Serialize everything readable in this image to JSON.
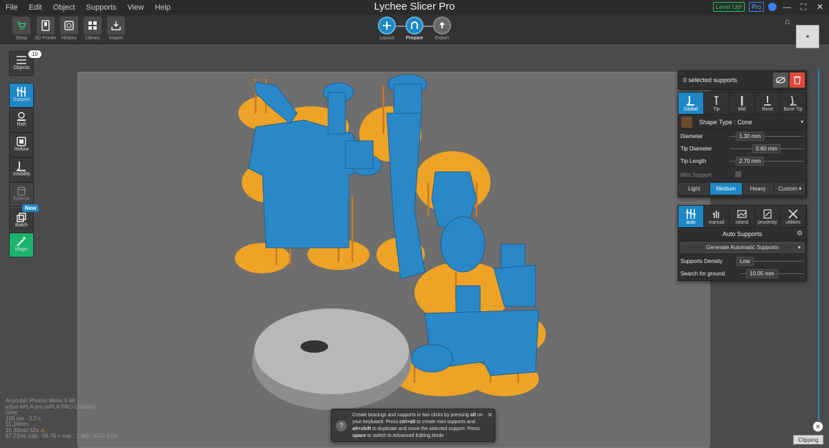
{
  "menu": [
    "File",
    "Edit",
    "Object",
    "Supports",
    "View",
    "Help"
  ],
  "app_title": "Lychee Slicer Pro",
  "menubar_right": {
    "levelup": "Level Up!",
    "pro": "Pro"
  },
  "toolbar": {
    "tools": [
      "Shop",
      "3D Printer",
      "History",
      "Library",
      "Import"
    ],
    "steps": [
      "Layout",
      "Prepare",
      "Export"
    ],
    "active_step": "Prepare"
  },
  "sidebar": {
    "objects_label": "Objects",
    "objects_count": "10",
    "support_label": "Support",
    "raft_label": "Raft",
    "hollow_label": "Hollow",
    "visibility_label": "Visibility",
    "exterior_label": "Exterior",
    "batch_label": "Batch",
    "new_badge": "New",
    "magic_label": "Magic"
  },
  "selection": {
    "text": "0 selected supports"
  },
  "support_settings": {
    "tabs": [
      "Global",
      "Tip",
      "Mid",
      "Base",
      "Base Tip"
    ],
    "active_tab": "Global",
    "shape_type": "Shape Type : Cone",
    "diameter_label": "Diameter",
    "diameter": "1.30 mm",
    "tip_diameter_label": "Tip Diameter",
    "tip_diameter": "0.60 mm",
    "tip_length_label": "Tip Length",
    "tip_length": "2.70 mm",
    "mini_support_label": "Mini Support",
    "density_options": [
      "Light",
      "Medium",
      "Heavy",
      "Custom ▾"
    ],
    "active_density": "Medium"
  },
  "auto_supports": {
    "tabs": [
      "auto",
      "manual",
      "island",
      "proximity",
      "utilities"
    ],
    "active_tab": "auto",
    "title": "Auto Supports",
    "generate_label": "Generate Automatic Supports",
    "density_label": "Supports Density",
    "density_value": "Low",
    "ground_label": "Search for ground",
    "ground_value": "10.05 mm"
  },
  "clipping_label": "Clipping",
  "tooltip": {
    "line1": "Create bracings and supports in two clicks by pressing",
    "key1": "alt",
    "line2": "on your keyboard. Press",
    "key2": "ctrl+alt",
    "line3": "to create mini supports",
    "line4": "and",
    "key3": "alt+shift",
    "line5": "to duplicate and move the selected support.",
    "line6": "Press",
    "key4": "space",
    "line7": "to switch to Advanced Editing Mode"
  },
  "info": {
    "printer": "Anycubic Photon Mono X 6K",
    "resin": "eSun ePLA pro (ePLA PRO Column)",
    "color": "Grey",
    "layer": "100 um - 3.2 s",
    "height": "51.19mm",
    "time": "1h 30min 52s",
    "volume": "67.22mL (obj : 59.76 + sup : 7.46) - AUD 4.04"
  },
  "colors": {
    "accent": "#1e88c7",
    "model": "#2b88c8",
    "support": "#c8782a",
    "raft": "#f5a623",
    "danger": "#e04a3a",
    "magic": "#1bb36e"
  }
}
